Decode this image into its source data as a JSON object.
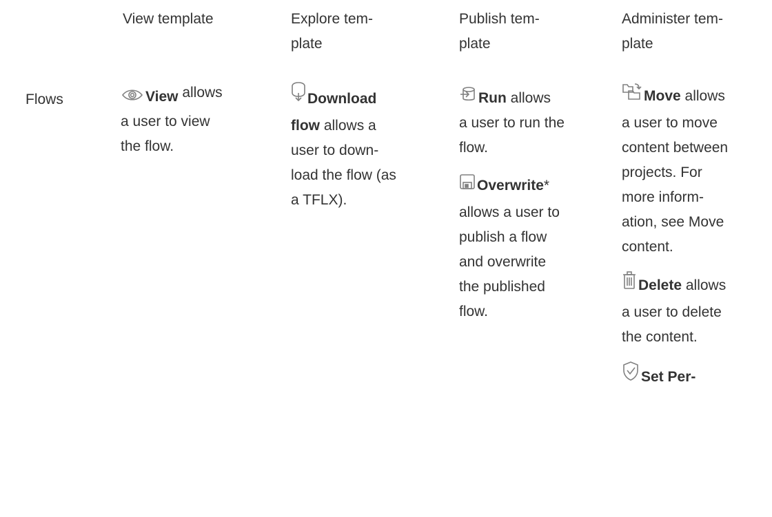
{
  "headers": {
    "view": [
      "View template"
    ],
    "explore": [
      "Explore tem-",
      "plate"
    ],
    "publish": [
      "Publish tem-",
      "plate"
    ],
    "administer": [
      "Administer tem-",
      "plate"
    ]
  },
  "row_label": "Flows",
  "view": {
    "icon": "eye-icon",
    "title": "View",
    "lead": "allows",
    "lines": [
      "a user to view",
      "the flow."
    ]
  },
  "explore": {
    "icon": "download-flow-icon",
    "title": "Download",
    "lines_first": "flow",
    "lines_first_rest": " allows a",
    "lines": [
      "user to down-",
      "load the flow (as",
      "a TFLX)."
    ]
  },
  "publish": [
    {
      "icon": "run-icon",
      "title": "Run",
      "lead": " allows",
      "lines": [
        "a user to run the",
        "flow."
      ]
    },
    {
      "icon": "overwrite-icon",
      "title": "Overwrite",
      "lead": "*",
      "lines": [
        "allows a user to",
        "publish a flow",
        "and overwrite",
        "the published",
        "flow."
      ]
    }
  ],
  "administer": [
    {
      "icon": "move-icon",
      "title": "Move",
      "lead": " allows",
      "lines": [
        "a user to move",
        "content between",
        "projects. For",
        "more inform-",
        "ation, see Move",
        "content."
      ]
    },
    {
      "icon": "delete-icon",
      "title": "Delete",
      "lead": " allows",
      "lines": [
        "a user to delete",
        "the content."
      ]
    },
    {
      "icon": "set-permissions-icon",
      "title": "Set Per-",
      "lead": "",
      "lines": []
    }
  ]
}
